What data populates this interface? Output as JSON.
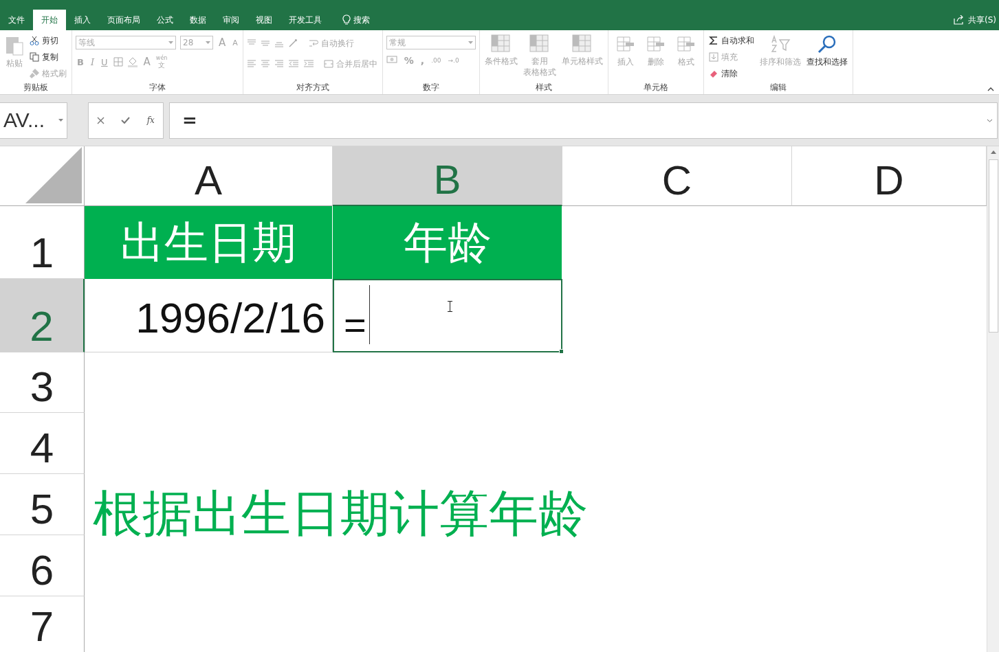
{
  "ribbon_tabs": [
    {
      "label": "文件",
      "selected": false
    },
    {
      "label": "开始",
      "selected": true
    },
    {
      "label": "插入",
      "selected": false
    },
    {
      "label": "页面布局",
      "selected": false
    },
    {
      "label": "公式",
      "selected": false
    },
    {
      "label": "数据",
      "selected": false
    },
    {
      "label": "审阅",
      "selected": false
    },
    {
      "label": "视图",
      "selected": false
    },
    {
      "label": "开发工具",
      "selected": false
    }
  ],
  "search": {
    "label": "搜索"
  },
  "share": {
    "label": "共享(S)"
  },
  "clipboard": {
    "title": "剪贴板",
    "paste": {
      "label": "粘贴",
      "disabled": true
    },
    "cut": {
      "label": "剪切",
      "disabled": false
    },
    "copy": {
      "label": "复制",
      "disabled": false
    },
    "painter": {
      "label": "格式刷",
      "disabled": true
    }
  },
  "font": {
    "title": "字体",
    "name": "等线",
    "size": "28",
    "grow": "A",
    "shrink": "A",
    "bold": "B",
    "italic": "I",
    "underline": "U",
    "font_color": "A",
    "phonetic_top": "wén",
    "phonetic_bottom": "文",
    "disabled": true
  },
  "alignment": {
    "title": "对齐方式",
    "wrap": "自动换行",
    "merge": "合并后居中",
    "disabled": true
  },
  "number": {
    "title": "数字",
    "format": "常规",
    "percent": "%",
    "comma": ",",
    "increase": ".00",
    "decrease": "→.0",
    "disabled": true
  },
  "styles": {
    "title": "样式",
    "items": [
      {
        "lines": [
          "条件格式"
        ],
        "disabled": true
      },
      {
        "lines": [
          "套用",
          "表格格式"
        ],
        "disabled": true
      },
      {
        "lines": [
          "单元格样式"
        ],
        "disabled": true
      }
    ]
  },
  "cells": {
    "title": "单元格",
    "items": [
      {
        "label": "插入",
        "disabled": true
      },
      {
        "label": "删除",
        "disabled": true
      },
      {
        "label": "格式",
        "disabled": true
      }
    ]
  },
  "editing": {
    "title": "编辑",
    "autosum": {
      "label": "自动求和",
      "disabled": false
    },
    "fill": {
      "label": "填充",
      "disabled": true
    },
    "clear": {
      "label": "清除",
      "disabled": false
    },
    "sort": {
      "label": "排序和筛选",
      "disabled": true
    },
    "find": {
      "label": "查找和选择",
      "disabled": false
    }
  },
  "formula_bar": {
    "name_box": "AV...",
    "function_button": "fx",
    "value": "="
  },
  "columns": [
    {
      "label": "A",
      "selected": false
    },
    {
      "label": "B",
      "selected": true
    },
    {
      "label": "C",
      "selected": false
    },
    {
      "label": "D",
      "selected": false
    }
  ],
  "rows": [
    {
      "label": "1",
      "selected": false,
      "cells": [
        {
          "kind": "header",
          "text": "出生日期"
        },
        {
          "kind": "header",
          "text": "年龄"
        }
      ]
    },
    {
      "label": "2",
      "selected": true,
      "cells": [
        {
          "kind": "value",
          "text": "1996/2/16"
        },
        {
          "kind": "editing",
          "text": "="
        }
      ]
    },
    {
      "label": "3",
      "selected": false,
      "cells": []
    },
    {
      "label": "4",
      "selected": false,
      "cells": []
    },
    {
      "label": "5",
      "selected": false,
      "cells": [
        {
          "kind": "note",
          "text": "根据出生日期计算年龄"
        }
      ]
    },
    {
      "label": "6",
      "selected": false,
      "cells": []
    },
    {
      "label": "7",
      "selected": false,
      "cells": []
    }
  ]
}
